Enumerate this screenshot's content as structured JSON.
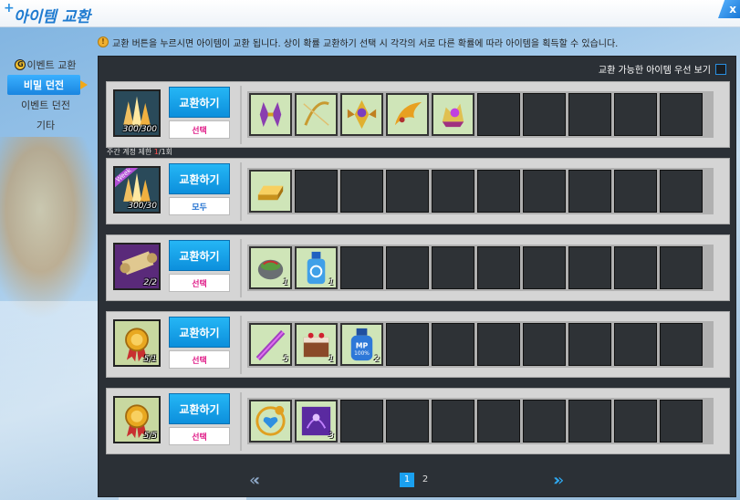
{
  "window": {
    "title": "아이템 교환",
    "close": "x"
  },
  "notice": {
    "icon": "notice-icon",
    "text": "교환 버튼을 누르시면 아이템이 교환 됩니다. 상이 확률 교환하기 선택 시 각각의 서로 다른 확률에 따라 아이템을 획득할 수 있습니다."
  },
  "sidebar": {
    "header": "이벤트 교환",
    "items": [
      {
        "label": "비밀 던전",
        "active": true
      },
      {
        "label": "이벤트 던전",
        "active": false
      },
      {
        "label": "기타",
        "active": false
      }
    ]
  },
  "priority_toggle": {
    "label": "교환 가능한 아이템 우선 보기",
    "checked": false
  },
  "rows": [
    {
      "count": "300/300",
      "button": "교환하기",
      "select": "선택",
      "select_color": "#e0208a",
      "item_kind": "crystal",
      "weekly": false,
      "limit": "",
      "slots": [
        {
          "icon": "purple-blade-icon",
          "qty": ""
        },
        {
          "icon": "golden-bow-icon",
          "qty": ""
        },
        {
          "icon": "winged-emblem-icon",
          "qty": ""
        },
        {
          "icon": "gold-wing-icon",
          "qty": ""
        },
        {
          "icon": "gem-crown-icon",
          "qty": ""
        }
      ]
    },
    {
      "count": "300/30",
      "button": "교환하기",
      "select": "모두",
      "select_color": "#2070d0",
      "item_kind": "crystal",
      "weekly": true,
      "weekly_text": "Week",
      "limit_prefix": "주간 계정 제한 ",
      "limit_value": "1",
      "limit_suffix": "/1회",
      "slots": [
        {
          "icon": "gold-bar-icon",
          "qty": ""
        }
      ]
    },
    {
      "count": "2/2",
      "button": "교환하기",
      "select": "선택",
      "select_color": "#e0208a",
      "item_kind": "scroll",
      "weekly": false,
      "limit": "",
      "slots": [
        {
          "icon": "stone-bowl-icon",
          "qty": "1"
        },
        {
          "icon": "potion-bottle-icon",
          "qty": "1"
        }
      ]
    },
    {
      "count": "5/1",
      "button": "교환하기",
      "select": "선택",
      "select_color": "#e0208a",
      "item_kind": "medal",
      "weekly": false,
      "limit": "",
      "slots": [
        {
          "icon": "purple-staff-icon",
          "qty": "5"
        },
        {
          "icon": "choco-cake-icon",
          "qty": "1"
        },
        {
          "icon": "mp-potion-icon",
          "qty": "2"
        }
      ]
    },
    {
      "count": "5/5",
      "button": "교환하기",
      "select": "선택",
      "select_color": "#e0208a",
      "item_kind": "medal",
      "weekly": false,
      "limit": "",
      "slots": [
        {
          "icon": "heart-amulet-icon",
          "qty": ""
        },
        {
          "icon": "purple-card-icon",
          "qty": "3"
        }
      ]
    }
  ],
  "pager": {
    "pages": [
      "1",
      "2"
    ],
    "current": "1",
    "prev": "«‹",
    "next": "›»"
  }
}
